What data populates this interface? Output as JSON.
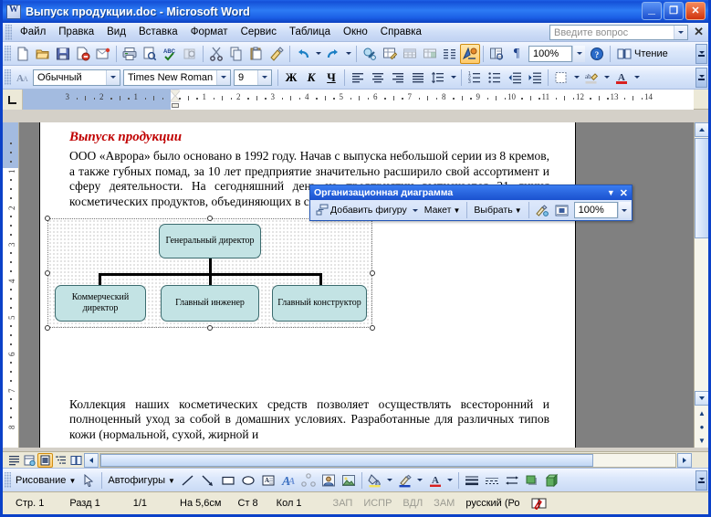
{
  "window": {
    "title": "Выпуск продукции.doc - Microsoft Word",
    "app_icon": "word-document-icon",
    "minimize": "_",
    "maximize": "□",
    "close": "✕"
  },
  "menu": {
    "items": [
      {
        "label": "Файл",
        "accel": "Ф"
      },
      {
        "label": "Правка",
        "accel": "П"
      },
      {
        "label": "Вид",
        "accel": "В"
      },
      {
        "label": "Вставка",
        "accel": "с"
      },
      {
        "label": "Формат",
        "accel": "м"
      },
      {
        "label": "Сервис",
        "accel": "в"
      },
      {
        "label": "Таблица",
        "accel": "Т"
      },
      {
        "label": "Окно",
        "accel": "О"
      },
      {
        "label": "Справка",
        "accel": "С"
      }
    ],
    "ask_placeholder": "Введите вопрос",
    "close_document": "✕"
  },
  "standard_toolbar": {
    "buttons": [
      {
        "name": "new-document-icon",
        "tip": "Создать"
      },
      {
        "name": "open-folder-icon",
        "tip": "Открыть"
      },
      {
        "name": "save-icon",
        "tip": "Сохранить"
      },
      {
        "name": "permission-icon",
        "tip": "Разрешения"
      },
      {
        "name": "email-icon",
        "tip": "Сообщение"
      },
      {
        "name": "print-icon",
        "tip": "Печать"
      },
      {
        "name": "print-preview-icon",
        "tip": "Предварительный просмотр"
      },
      {
        "name": "spelling-icon",
        "tip": "Правописание"
      },
      {
        "name": "research-icon",
        "tip": "Справочные материалы"
      },
      {
        "name": "cut-icon",
        "tip": "Вырезать"
      },
      {
        "name": "copy-icon",
        "tip": "Копировать"
      },
      {
        "name": "paste-icon",
        "tip": "Вставить"
      },
      {
        "name": "format-painter-icon",
        "tip": "Формат по образцу"
      },
      {
        "name": "undo-icon",
        "tip": "Отменить"
      },
      {
        "name": "redo-icon",
        "tip": "Вернуть"
      },
      {
        "name": "hyperlink-icon",
        "tip": "Гиперссылка"
      },
      {
        "name": "tables-and-borders-icon",
        "tip": "Таблицы и границы"
      },
      {
        "name": "insert-table-icon",
        "tip": "Добавить таблицу"
      },
      {
        "name": "insert-excel-sheet-icon",
        "tip": "Лист Excel"
      },
      {
        "name": "columns-icon",
        "tip": "Колонки"
      },
      {
        "name": "drawing-icon",
        "tip": "Рисование"
      },
      {
        "name": "document-map-icon",
        "tip": "Схема документа"
      },
      {
        "name": "show-formatting-marks-icon",
        "tip": "Непечатаемые знаки"
      }
    ],
    "zoom_value": "100%",
    "help_icon": "help-icon",
    "reading_label": "Чтение",
    "reading_icon": "reading-layout-icon",
    "overflow": "toolbar-options-icon"
  },
  "formatting_toolbar": {
    "styles_icon": "style-icon",
    "style_value": "Обычный",
    "font_value": "Times New Roman",
    "size_value": "9",
    "bold": "Ж",
    "italic": "К",
    "underline": "Ч",
    "buttons": [
      {
        "name": "align-left-icon"
      },
      {
        "name": "align-center-icon"
      },
      {
        "name": "align-right-icon"
      },
      {
        "name": "align-justify-icon"
      },
      {
        "name": "line-spacing-icon"
      },
      {
        "name": "numbered-list-icon"
      },
      {
        "name": "bulleted-list-icon"
      },
      {
        "name": "decrease-indent-icon"
      },
      {
        "name": "increase-indent-icon"
      },
      {
        "name": "borders-icon"
      },
      {
        "name": "highlight-color-icon"
      },
      {
        "name": "font-color-icon"
      }
    ]
  },
  "ruler": {
    "horizontal_labels": [
      "3",
      "2",
      "1",
      "1",
      "2",
      "3",
      "4",
      "5",
      "6",
      "7",
      "8",
      "9",
      "10",
      "11",
      "12",
      "13",
      "14"
    ],
    "vertical_labels": [
      "1",
      "1",
      "2",
      "3",
      "4",
      "5",
      "6",
      "7",
      "8"
    ],
    "tab_selector": "left-tab-icon"
  },
  "org_diagram_toolbar": {
    "title": "Организационная диаграмма",
    "add_shape": "Добавить фигуру",
    "layout": "Макет",
    "select": "Выбрать",
    "autoformat_icon": "autoformat-icon",
    "text_wrapping_icon": "text-wrapping-icon",
    "zoom_value": "100%",
    "dropdown_icon": "toolbar-options-icon",
    "close_icon": "close-icon"
  },
  "document": {
    "heading": "Выпуск продукции",
    "paragraph1": "ООО «Аврора» было основано в 1992 году. Начав с выпуска небольшой серии из 8 кремов, а также губных помад, за 10 лет предприятие значительно расширило свой ассортимент и сферу деятельности. На сегодняшний день на предприятии выпускается 21 линия косметических продуктов, объединяющих в себе 134 наименования.",
    "paragraph2": "Коллекция наших косметических средств позволяет осуществлять всесторонний и полноценный уход за собой в домашних условиях. Разработанные для различных типов кожи (нормальной, сухой, жирной и",
    "org_chart": {
      "root": "Генеральный директор",
      "children": [
        "Коммерческий директор",
        "Главный инженер",
        "Главный конструктор"
      ],
      "node_fill": "#c3e3e4",
      "node_border": "#3b6b6e"
    }
  },
  "view_buttons": [
    {
      "name": "normal-view-icon",
      "active": false
    },
    {
      "name": "web-layout-view-icon",
      "active": false
    },
    {
      "name": "print-layout-view-icon",
      "active": true
    },
    {
      "name": "outline-view-icon",
      "active": false
    },
    {
      "name": "reading-layout-view-icon",
      "active": false
    }
  ],
  "drawing_toolbar": {
    "menu_label": "Рисование",
    "select_icon": "select-arrow-icon",
    "autoshapes_label": "Автофигуры",
    "buttons": [
      {
        "name": "line-icon"
      },
      {
        "name": "arrow-icon"
      },
      {
        "name": "rectangle-icon"
      },
      {
        "name": "oval-icon"
      },
      {
        "name": "text-box-icon"
      },
      {
        "name": "wordart-icon"
      },
      {
        "name": "diagram-icon"
      },
      {
        "name": "clip-art-icon"
      },
      {
        "name": "picture-icon"
      },
      {
        "name": "fill-color-icon"
      },
      {
        "name": "line-color-icon"
      },
      {
        "name": "font-color-icon"
      },
      {
        "name": "line-style-icon"
      },
      {
        "name": "dash-style-icon"
      },
      {
        "name": "arrow-style-icon"
      },
      {
        "name": "shadow-style-icon"
      },
      {
        "name": "3d-style-icon"
      }
    ],
    "overflow": "toolbar-options-icon"
  },
  "status_bar": {
    "page": "Стр. 1",
    "section": "Разд 1",
    "page_of": "1/1",
    "at": "На 5,6см",
    "line": "Ст 8",
    "column": "Кол 1",
    "rec": "ЗАП",
    "trk": "ИСПР",
    "ext": "ВДЛ",
    "ovr": "ЗАМ",
    "language": "русский (Ро",
    "spell_icon": "spelling-status-icon"
  },
  "colors": {
    "titlebar_blue": "#1b5fe6",
    "accent_orange": "#ffca6b",
    "heading_red": "#c00000",
    "diagram_fill": "#c3e3e4",
    "page_bg": "#808080"
  }
}
